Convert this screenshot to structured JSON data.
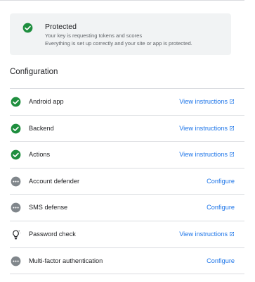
{
  "status": {
    "title": "Protected",
    "line1": "Your key is requesting tokens and scores",
    "line2": "Everything is set up correctly and your site or app is protected.",
    "icon": "check-circle-icon",
    "icon_color": "#1e8e3e"
  },
  "section_title": "Configuration",
  "colors": {
    "success": "#1e8e3e",
    "pending": "#80868b",
    "link": "#1a73e8"
  },
  "items": [
    {
      "label": "Android app",
      "status_icon": "check-circle-icon",
      "action": "View instructions",
      "external": true
    },
    {
      "label": "Backend",
      "status_icon": "check-circle-icon",
      "action": "View instructions",
      "external": true
    },
    {
      "label": "Actions",
      "status_icon": "check-circle-icon",
      "action": "View instructions",
      "external": true
    },
    {
      "label": "Account defender",
      "status_icon": "more-horiz-circle-icon",
      "action": "Configure",
      "external": false
    },
    {
      "label": "SMS defense",
      "status_icon": "more-horiz-circle-icon",
      "action": "Configure",
      "external": false
    },
    {
      "label": "Password check",
      "status_icon": "lightbulb-icon",
      "action": "View instructions",
      "external": true
    },
    {
      "label": "Multi-factor authentication",
      "status_icon": "more-horiz-circle-icon",
      "action": "Configure",
      "external": false
    }
  ]
}
